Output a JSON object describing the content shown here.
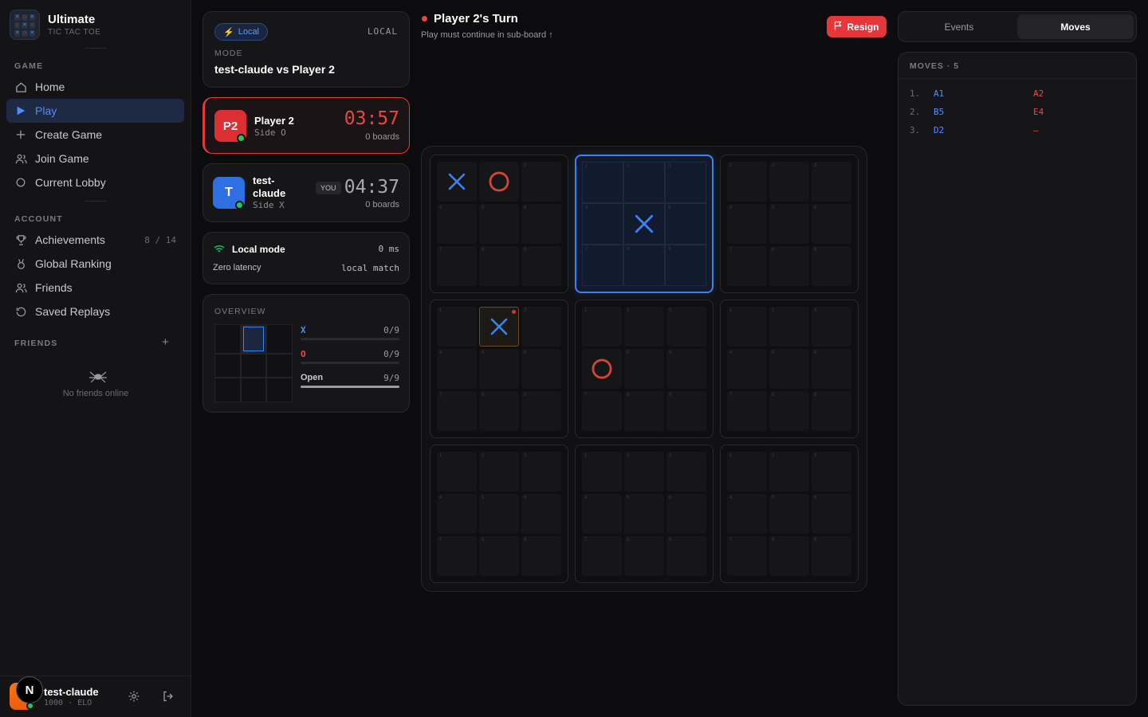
{
  "brand": {
    "title": "Ultimate",
    "subtitle": "TIC TAC TOE"
  },
  "sidebar": {
    "game_label": "GAME",
    "game_items": [
      {
        "label": "Home",
        "icon": "home-icon"
      },
      {
        "label": "Play",
        "icon": "play-icon",
        "active": true
      },
      {
        "label": "Create Game",
        "icon": "plus-icon"
      },
      {
        "label": "Join Game",
        "icon": "users-icon"
      },
      {
        "label": "Current Lobby",
        "icon": "circle-icon"
      }
    ],
    "account_label": "ACCOUNT",
    "account_items": [
      {
        "label": "Achievements",
        "icon": "trophy-icon",
        "count": "8 / 14"
      },
      {
        "label": "Global Ranking",
        "icon": "medal-icon"
      },
      {
        "label": "Friends",
        "icon": "friends-icon"
      },
      {
        "label": "Saved Replays",
        "icon": "history-icon"
      }
    ],
    "friends_label": "FRIENDS",
    "add_friend": "+",
    "no_friends": "No friends online"
  },
  "user": {
    "name": "test-claude",
    "elo": "1000 · ELO",
    "badge": "N"
  },
  "mode_card": {
    "pill": "Local",
    "tag": "LOCAL",
    "label": "MODE",
    "value": "test-claude vs Player 2"
  },
  "players": [
    {
      "avatar": "P2",
      "name": "Player 2",
      "side": "Side O",
      "time": "03:57",
      "boards": "0 boards",
      "active": true
    },
    {
      "avatar": "T",
      "name": "test-\nclaude",
      "you": "YOU",
      "side": "Side X",
      "time": "04:37",
      "boards": "0 boards"
    }
  ],
  "connection": {
    "title": "Local mode",
    "ms": "0 ms",
    "latency": "Zero latency",
    "match": "local match"
  },
  "overview": {
    "label": "OVERVIEW",
    "rows": [
      {
        "label": "X",
        "count": "0/9",
        "fraction": 0,
        "color": "#4f8cff"
      },
      {
        "label": "O",
        "count": "0/9",
        "fraction": 0,
        "color": "#ef4444"
      },
      {
        "label": "Open",
        "count": "9/9",
        "fraction": 1,
        "color": "#c9c9cf"
      }
    ],
    "active_board": 1
  },
  "turn": {
    "title": "Player 2's Turn",
    "subtitle": "Play must continue in sub-board ↑"
  },
  "resign": "Resign",
  "board": {
    "active_sub": 1,
    "cells": [
      [
        "X",
        "O",
        "",
        "",
        "",
        "",
        "",
        "",
        ""
      ],
      [
        "",
        "",
        "",
        "",
        "X",
        "",
        "",
        "",
        ""
      ],
      [
        "",
        "",
        "",
        "",
        "",
        "",
        "",
        "",
        ""
      ],
      [
        "",
        "X",
        "",
        "",
        "",
        "",
        "",
        "",
        ""
      ],
      [
        "",
        "",
        "",
        "O",
        "",
        "",
        "",
        "",
        ""
      ],
      [
        "",
        "",
        "",
        "",
        "",
        "",
        "",
        "",
        ""
      ],
      [
        "",
        "",
        "",
        "",
        "",
        "",
        "",
        "",
        ""
      ],
      [
        "",
        "",
        "",
        "",
        "",
        "",
        "",
        "",
        ""
      ],
      [
        "",
        "",
        "",
        "",
        "",
        "",
        "",
        "",
        ""
      ]
    ],
    "last_move": [
      3,
      1
    ]
  },
  "tabs": {
    "events": "Events",
    "moves": "Moves"
  },
  "moves": {
    "label": "MOVES · 5",
    "list": [
      {
        "num": "1.",
        "x": "A1",
        "o": "A2"
      },
      {
        "num": "2.",
        "x": "B5",
        "o": "E4"
      },
      {
        "num": "3.",
        "x": "D2",
        "o": "—"
      }
    ]
  }
}
